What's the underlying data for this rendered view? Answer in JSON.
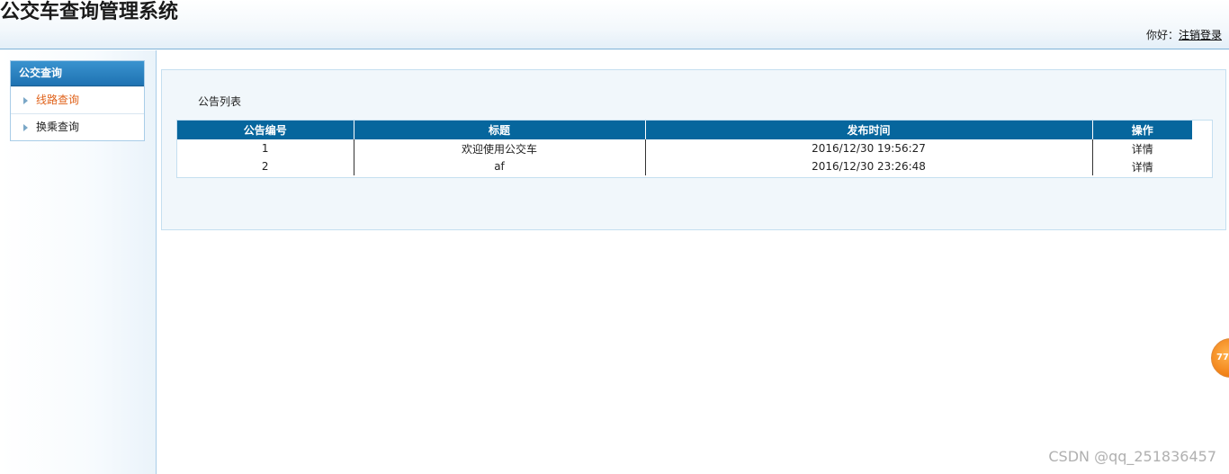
{
  "header": {
    "app_title": "公交车查询管理系统",
    "greeting": "你好：",
    "logout_label": "注销登录"
  },
  "sidebar": {
    "section_title": "公交查询",
    "items": [
      {
        "label": "线路查询",
        "active": true
      },
      {
        "label": "换乘查询",
        "active": false
      }
    ]
  },
  "main": {
    "panel_title": "公告列表",
    "table": {
      "columns": [
        "公告编号",
        "标题",
        "发布时间",
        "操作"
      ],
      "rows": [
        {
          "id": "1",
          "title": "欢迎使用公交车",
          "time": "2016/12/30 19:56:27",
          "action": "详情"
        },
        {
          "id": "2",
          "title": "af",
          "time": "2016/12/30 23:26:48",
          "action": "详情"
        }
      ]
    }
  },
  "float_badge": {
    "text": "77"
  },
  "watermark": "CSDN @qq_251836457",
  "colors": {
    "table_header": "#06669d",
    "menu_header": "#1f72b2",
    "active_item": "#e0621a",
    "badge": "#f07d12"
  }
}
